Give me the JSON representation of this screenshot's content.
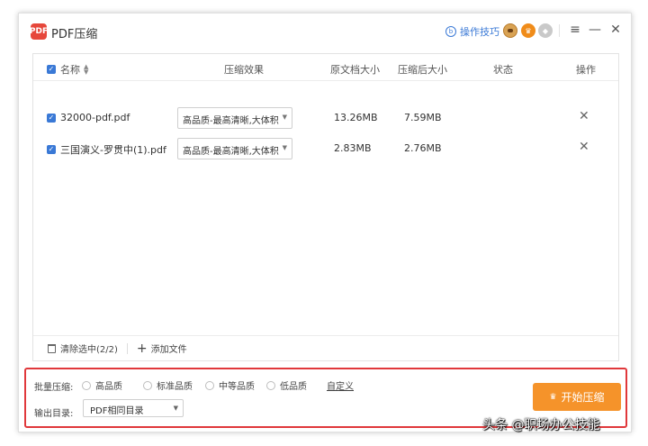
{
  "app": {
    "title": "PDF压缩",
    "logo_text": "PDF"
  },
  "header": {
    "tips_label": "操作技巧",
    "tips_icon": "b",
    "menu_glyph": "≡",
    "minimize_glyph": "—",
    "close_glyph": "✕"
  },
  "table": {
    "headers": {
      "name": "名称",
      "effect": "压缩效果",
      "original_size": "原文档大小",
      "compressed_size": "压缩后大小",
      "status": "状态",
      "action": "操作"
    },
    "rows": [
      {
        "name": "32000-pdf.pdf",
        "quality": "高品质-最高清晰,大体积",
        "original_size": "13.26MB",
        "compressed_size": "7.59MB",
        "status": "",
        "checked": true
      },
      {
        "name": "三国演义-罗贯中(1).pdf",
        "quality": "高品质-最高清晰,大体积",
        "original_size": "2.83MB",
        "compressed_size": "2.76MB",
        "status": "",
        "checked": true
      }
    ],
    "footer": {
      "clear_label": "清除选中(2/2)",
      "add_label": "添加文件"
    }
  },
  "settings": {
    "batch_label": "批量压缩:",
    "options": [
      "高品质",
      "标准品质",
      "中等品质",
      "低品质"
    ],
    "custom_label": "自定义",
    "output_label": "输出目录:",
    "output_value": "PDF相同目录",
    "start_label": "开始压缩",
    "highlight_color": "#e0383b",
    "accent_color": "#f5932a"
  },
  "watermark": "头条 @职场办公技能"
}
